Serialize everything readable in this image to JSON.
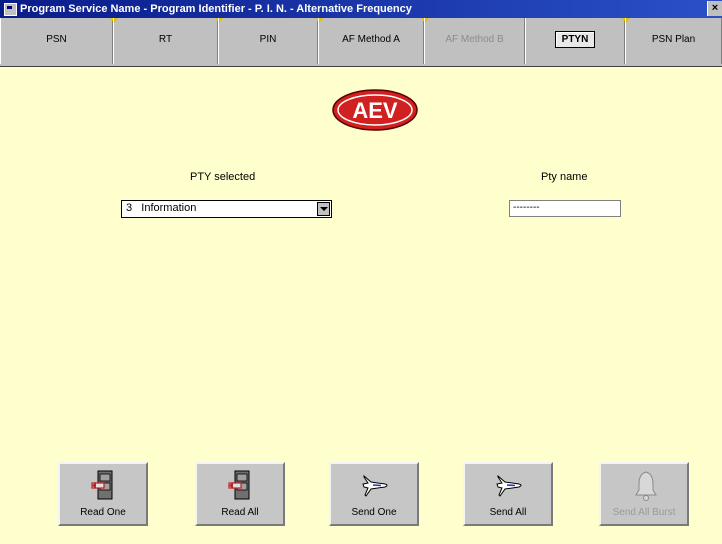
{
  "window": {
    "title": "Program Service Name - Program Identifier - P. I. N. - Alternative Frequency",
    "close_label": "×"
  },
  "tabs": [
    {
      "label": "PSN",
      "state": "normal"
    },
    {
      "label": "RT",
      "state": "normal"
    },
    {
      "label": "PIN",
      "state": "normal"
    },
    {
      "label": "AF Method A",
      "state": "normal"
    },
    {
      "label": "AF Method B",
      "state": "disabled"
    },
    {
      "label": "PTYN",
      "state": "active"
    },
    {
      "label": "PSN Plan",
      "state": "normal"
    }
  ],
  "logo": {
    "text": "AEV",
    "color": "#d02020"
  },
  "pty": {
    "label": "PTY selected",
    "selected_value": "3   Information"
  },
  "ptyname": {
    "label": "Pty name",
    "value": "--------"
  },
  "buttons": {
    "read_one": "Read One",
    "read_all": "Read All",
    "send_one": "Send One",
    "send_all": "Send All",
    "send_all_burst": "Send All Burst"
  },
  "colors": {
    "background": "#fffecd",
    "titlebar": "#0a1c8a",
    "tabs": "#c0c0c0"
  }
}
